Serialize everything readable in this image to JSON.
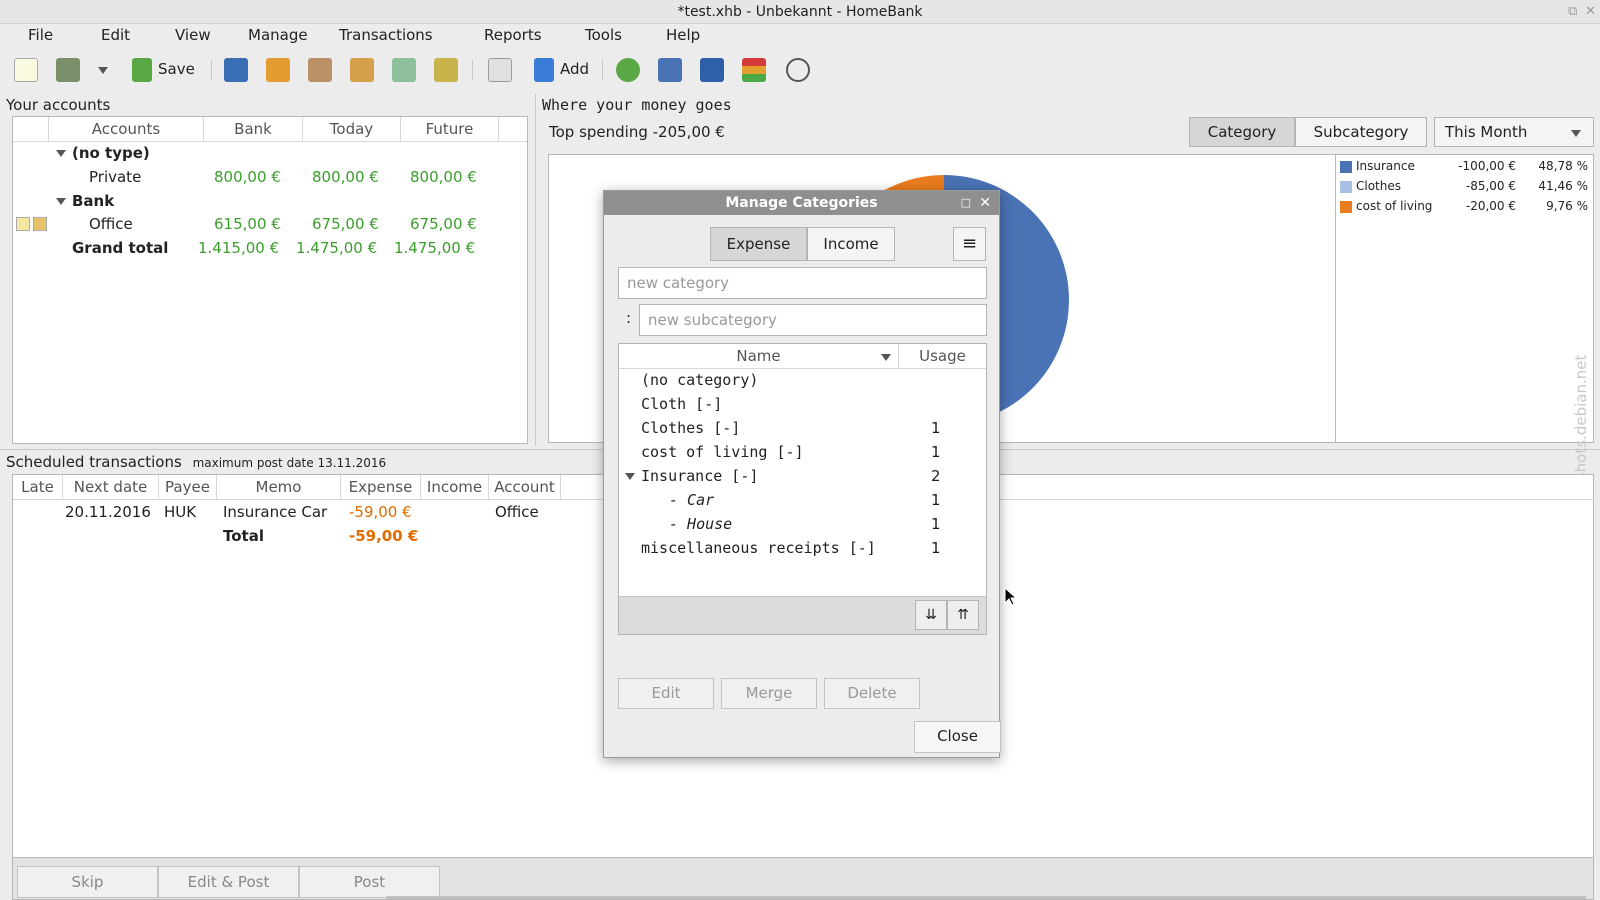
{
  "window": {
    "title": "*test.xhb - Unbekannt - HomeBank"
  },
  "menu": [
    "File",
    "Edit",
    "View",
    "Manage",
    "Transactions",
    "Reports",
    "Tools",
    "Help"
  ],
  "toolbar": {
    "save_label": "Save",
    "add_label": "Add"
  },
  "accounts": {
    "heading": "Your accounts",
    "columns": [
      "Accounts",
      "Bank",
      "Today",
      "Future"
    ],
    "group1": {
      "name": "(no type)"
    },
    "private": {
      "name": "Private",
      "bank": "800,00 €",
      "today": "800,00 €",
      "future": "800,00 €"
    },
    "group2": {
      "name": "Bank"
    },
    "office": {
      "name": "Office",
      "bank": "615,00 €",
      "today": "675,00 €",
      "future": "675,00 €"
    },
    "total": {
      "name": "Grand total",
      "bank": "1.415,00 €",
      "today": "1.475,00 €",
      "future": "1.475,00 €"
    }
  },
  "spending": {
    "heading": "Where your money goes",
    "top": "Top spending -205,00 €",
    "btn_category": "Category",
    "btn_subcategory": "Subcategory",
    "range": "This Month",
    "legend": [
      {
        "name": "Insurance",
        "amount": "-100,00 €",
        "pct": "48,78 %",
        "color": "#4a73b5"
      },
      {
        "name": "Clothes",
        "amount": "-85,00 €",
        "pct": "41,46 %",
        "color": "#a9bfe6"
      },
      {
        "name": "cost of living",
        "amount": "-20,00 €",
        "pct": "9,76 %",
        "color": "#e97c1e"
      }
    ]
  },
  "chart_data": {
    "type": "pie",
    "categories": [
      "Insurance",
      "Clothes",
      "cost of living"
    ],
    "values": [
      100,
      85,
      20
    ],
    "colors": [
      "#4a73b5",
      "#a9bfe6",
      "#e97c1e"
    ]
  },
  "scheduled": {
    "heading": "Scheduled transactions",
    "maxdate": "maximum post date 13.11.2016",
    "columns": [
      "Late",
      "Next date",
      "Payee",
      "Memo",
      "Expense",
      "Income",
      "Account"
    ],
    "row": {
      "late": "",
      "date": "20.11.2016",
      "payee": "HUK",
      "memo": "Insurance Car",
      "expense": "-59,00 €",
      "income": "",
      "account": "Office"
    },
    "total_label": "Total",
    "total_expense": "-59,00 €",
    "btn_skip": "Skip",
    "btn_editpost": "Edit & Post",
    "btn_post": "Post"
  },
  "dialog": {
    "title": "Manage Categories",
    "btn_expense": "Expense",
    "btn_income": "Income",
    "placeholder_category": "new category",
    "subsep": ":",
    "placeholder_subcategory": "new subcategory",
    "col_name": "Name",
    "col_usage": "Usage",
    "items": [
      {
        "name": "(no category)",
        "usage": ""
      },
      {
        "name": "Cloth [-]",
        "usage": ""
      },
      {
        "name": "Clothes [-]",
        "usage": "1"
      },
      {
        "name": "cost of living [-]",
        "usage": "1"
      },
      {
        "name": "Insurance [-]",
        "usage": "2"
      },
      {
        "name": "- Car",
        "usage": "1"
      },
      {
        "name": "- House",
        "usage": "1"
      },
      {
        "name": "miscellaneous receipts [-]",
        "usage": "1"
      }
    ],
    "btn_edit": "Edit",
    "btn_merge": "Merge",
    "btn_delete": "Delete",
    "btn_close": "Close"
  },
  "watermark": "screenshots.debian.net"
}
